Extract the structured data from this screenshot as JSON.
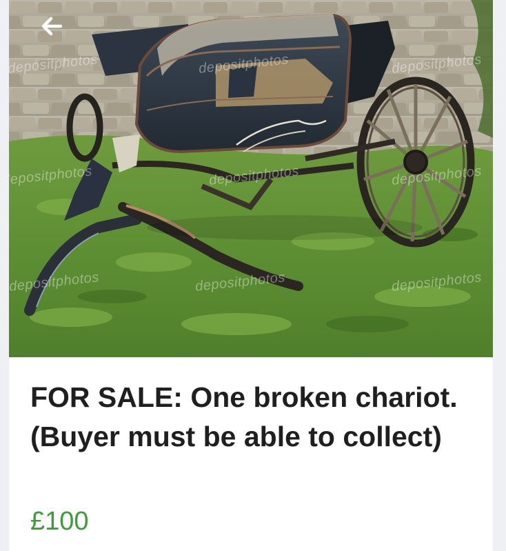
{
  "listing": {
    "title": "FOR SALE: One broken chariot. (Buyer must be able to collect)",
    "price": "£100",
    "price_color": "#3f9a3a"
  },
  "photo": {
    "subject": "broken carriage on grass",
    "watermark_text": "depositphotos"
  },
  "nav": {
    "back_icon": "arrow-left-icon"
  }
}
